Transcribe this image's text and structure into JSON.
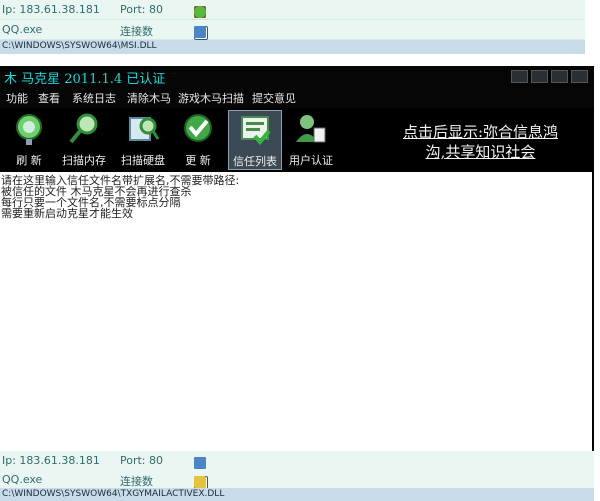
{
  "top_status": {
    "ip": "Ip: 183.61.38.181",
    "port": "Port: 80",
    "process": "QQ.exe",
    "conn": "连接数",
    "path": "C:\\WINDOWS\\SYSWOW64\\MSI.DLL"
  },
  "window": {
    "title": "木 马克星  2011.1.4   已认证",
    "menu": [
      "功能",
      "查看",
      "系统日志",
      "清除木马",
      "游戏木马扫描",
      "提交意见"
    ],
    "toolbar": [
      {
        "label": "刷 新",
        "icon": "globe-refresh-icon"
      },
      {
        "label": "扫描内存",
        "icon": "magnifier-memory-icon"
      },
      {
        "label": "扫描硬盘",
        "icon": "magnifier-disk-icon"
      },
      {
        "label": "更 新",
        "icon": "update-check-icon"
      },
      {
        "label": "信任列表",
        "icon": "trust-list-icon"
      },
      {
        "label": "用户认证",
        "icon": "user-auth-icon"
      }
    ],
    "promo_line1": "点击后显示:弥合信息鸿",
    "promo_line2": "沟,共享知识社会",
    "editor_lines": [
      "请在这里输入信任文件名带扩展名,不需要带路径:",
      "被信任的文件 木马克星不会再进行查杀",
      "每行只要一个文件名,不需要标点分隔",
      "需要重新启动克星才能生效"
    ]
  },
  "bottom_status": {
    "ip": "Ip: 183.61.38.181",
    "port": "Port: 80",
    "process": "QQ.exe",
    "conn": "连接数",
    "path": "C:\\WINDOWS\\SYSWOW64\\TXGYMAILACTIVEX.DLL"
  },
  "colors": {
    "title_cyan": "#16d6d6",
    "status_bg": "#eaf6f2",
    "path_bg": "#c8dbe8"
  }
}
